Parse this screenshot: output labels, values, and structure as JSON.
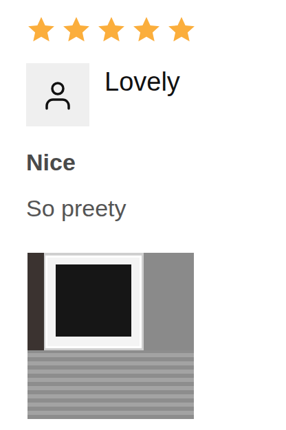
{
  "review": {
    "stars": 5,
    "author": "Lovely",
    "title": "Nice",
    "body": "So preety"
  }
}
